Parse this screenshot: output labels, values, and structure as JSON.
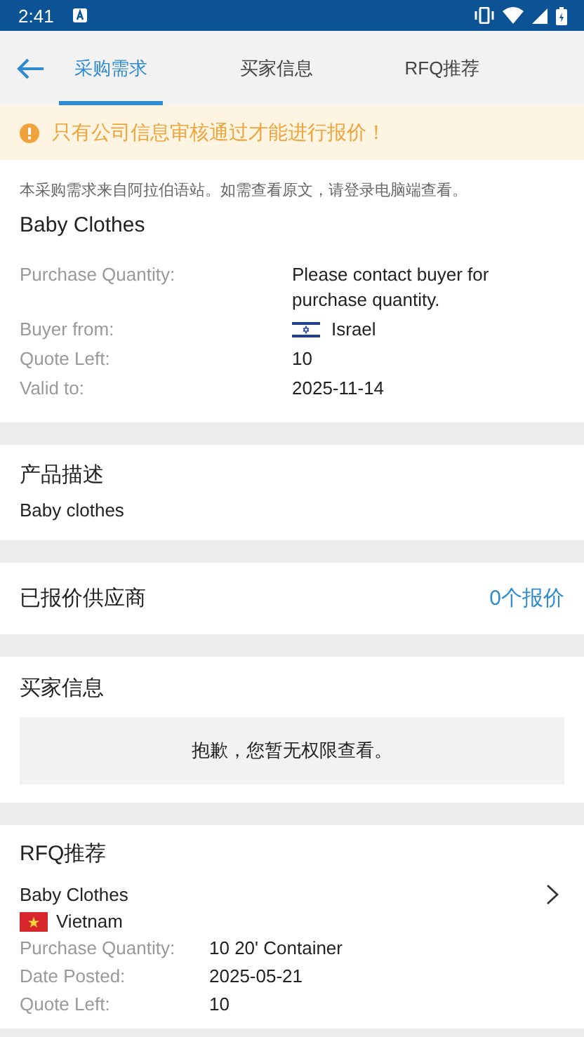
{
  "status_bar": {
    "time": "2:41"
  },
  "tabs": [
    {
      "label": "采购需求",
      "selected": true
    },
    {
      "label": "买家信息",
      "selected": false
    },
    {
      "label": "RFQ推荐",
      "selected": false
    }
  ],
  "warning": "只有公司信息审核通过才能进行报价！",
  "request": {
    "notice": "本采购需求来自阿拉伯语站。如需查看原文，请登录电脑端查看。",
    "title": "Baby Clothes",
    "fields": [
      {
        "label": "Purchase Quantity:",
        "value": "Please contact buyer for purchase quantity.",
        "kind": "text"
      },
      {
        "label": "Buyer from:",
        "value": "Israel",
        "kind": "country"
      },
      {
        "label": "Quote Left:",
        "value": "10",
        "kind": "text"
      },
      {
        "label": "Valid to:",
        "value": "2025-11-14",
        "kind": "text"
      }
    ]
  },
  "description": {
    "title": "产品描述",
    "text": "Baby clothes"
  },
  "suppliers": {
    "title": "已报价供应商",
    "link": "0个报价"
  },
  "buyer_info": {
    "title": "买家信息",
    "message": "抱歉，您暂无权限查看。"
  },
  "rfq": {
    "title": "RFQ推荐",
    "item": {
      "title": "Baby Clothes",
      "country": "Vietnam",
      "fields": [
        {
          "label": "Purchase Quantity:",
          "value": "10 20' Container"
        },
        {
          "label": "Date Posted:",
          "value": "2025-05-21"
        },
        {
          "label": "Quote Left:",
          "value": "10"
        }
      ]
    }
  }
}
